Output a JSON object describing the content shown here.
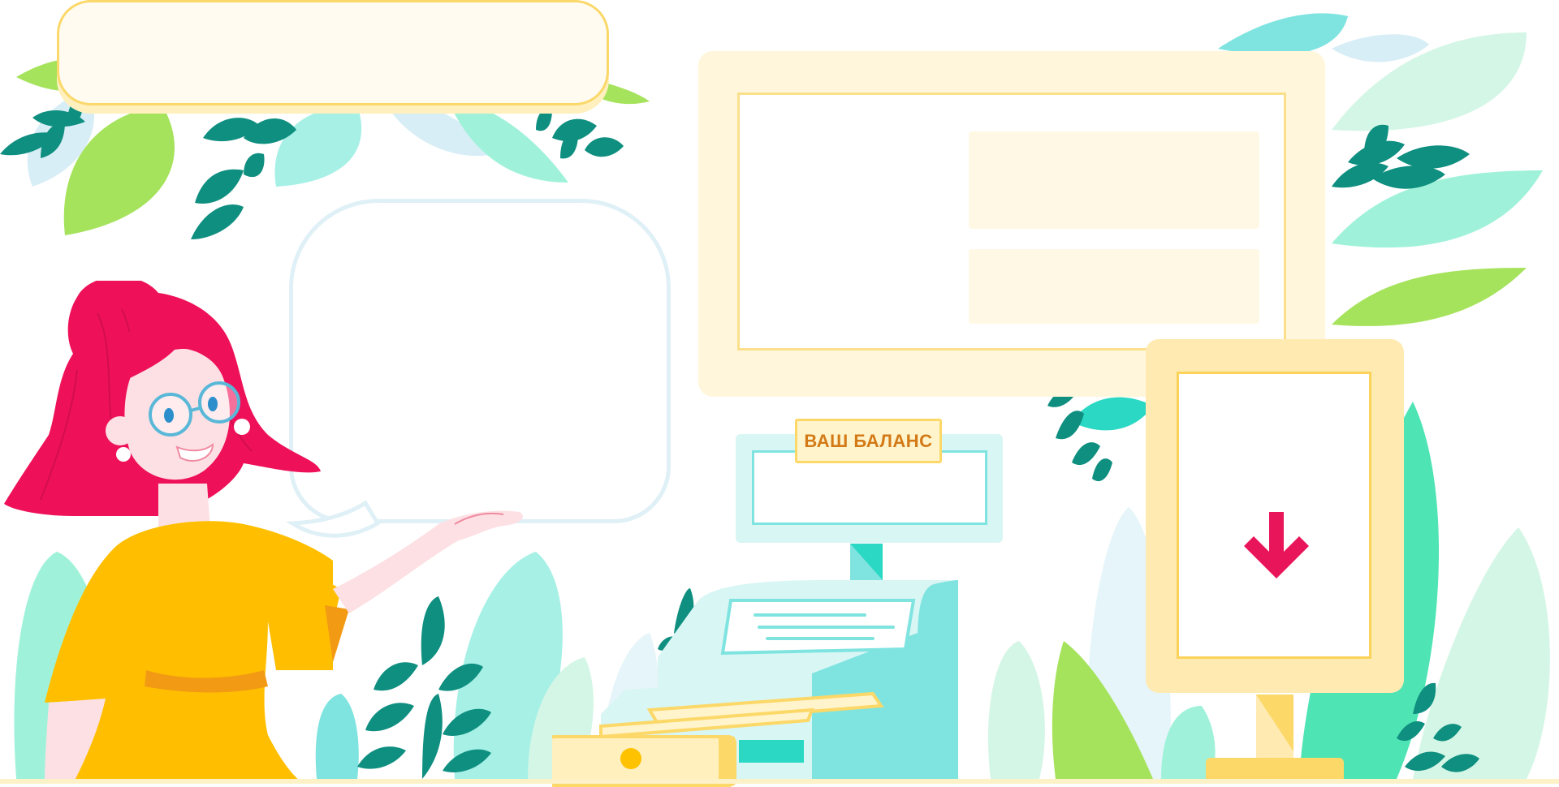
{
  "register": {
    "balance_label": "ВАШ БАЛАНС"
  },
  "icons": {
    "download": "arrow-down-icon",
    "character": "woman-presenter-illustration",
    "leaves": "leaf-decoration"
  },
  "colors": {
    "accent": "#e8155b",
    "teal": "#0f8f80",
    "mint": "#7fe4e0",
    "yellow": "#fcd868",
    "hair": "#ee1159",
    "dress": "#ffbf00"
  }
}
